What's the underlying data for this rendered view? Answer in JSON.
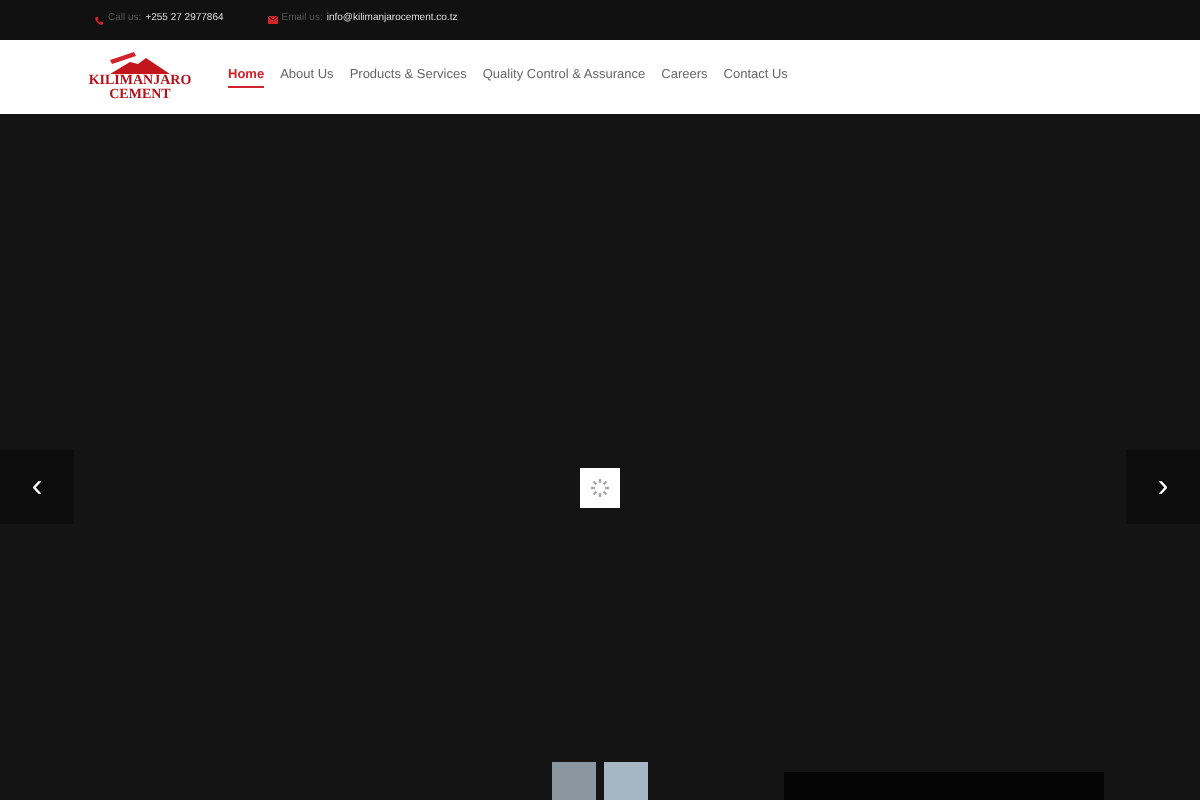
{
  "top_bar": {
    "phone_label": "Call us:",
    "phone": "+255 27 2977864",
    "email_label": "Email us:",
    "email": "info@kilimanjarocement.co.tz"
  },
  "logo": {
    "line_1": "KILIMANJARO",
    "line_2": "CEMENT"
  },
  "nav": [
    {
      "label": "Home",
      "selected": true
    },
    {
      "label": "About Us",
      "selected": false
    },
    {
      "label": "Products & Services",
      "selected": false
    },
    {
      "label": "Quality Control & Assurance",
      "selected": false
    },
    {
      "label": "Careers",
      "selected": false
    },
    {
      "label": "Contact Us",
      "selected": false
    }
  ],
  "slider": {
    "prev": "‹",
    "next": "›"
  }
}
